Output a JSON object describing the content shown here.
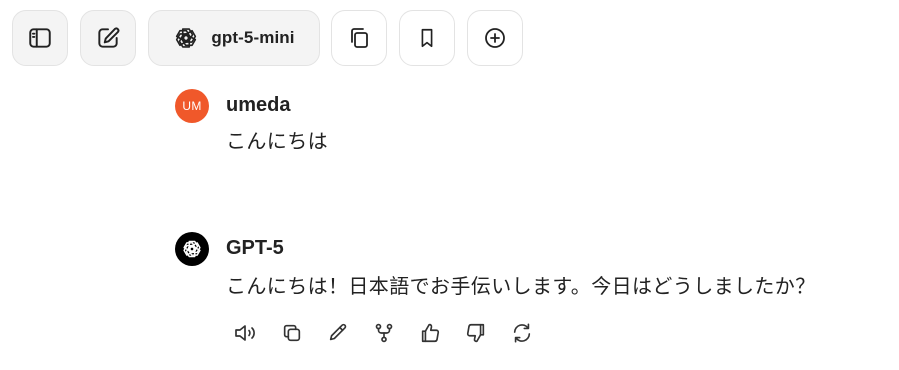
{
  "toolbar": {
    "sidebar_icon": "sidebar-toggle-icon",
    "new_chat_icon": "edit-icon",
    "model": {
      "icon": "openai-logo-icon",
      "label": "gpt-5-mini"
    },
    "copy_icon": "copy-icon",
    "bookmark_icon": "bookmark-icon",
    "add_icon": "plus-circle-icon"
  },
  "messages": [
    {
      "role": "user",
      "avatar_initials": "UM",
      "avatar_color": "#f0582a",
      "name": "umeda",
      "text": "こんにちは"
    },
    {
      "role": "assistant",
      "avatar_icon": "openai-logo-icon",
      "avatar_color": "#000000",
      "name": "GPT-5",
      "text": "こんにちは！日本語でお手伝いします。今日はどうしましたか？"
    }
  ],
  "message_actions": [
    "speaker-icon",
    "copy-icon",
    "edit-pencil-icon",
    "branch-icon",
    "thumbs-up-icon",
    "thumbs-down-icon",
    "regenerate-icon"
  ]
}
